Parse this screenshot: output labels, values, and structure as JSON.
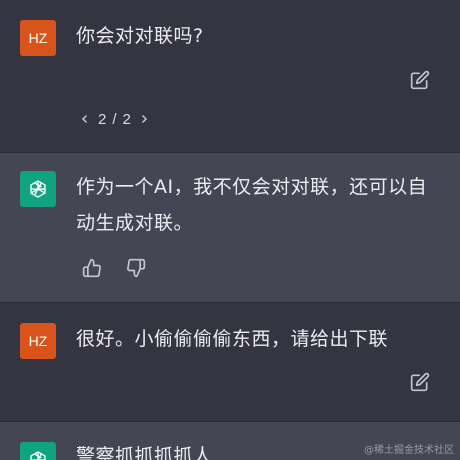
{
  "messages": [
    {
      "role": "user",
      "avatar_label": "HZ",
      "text": "你会对对联吗?",
      "pager": {
        "prev_icon": "chevron-left-icon",
        "current": "2",
        "separator": "/",
        "total": "2",
        "next_icon": "chevron-right-icon"
      },
      "edit_icon": "edit-icon"
    },
    {
      "role": "assistant",
      "avatar_icon": "openai-logo-icon",
      "text": "作为一个AI，我不仅会对对联，还可以自动生成对联。",
      "thumbs_up_icon": "thumbs-up-icon",
      "thumbs_down_icon": "thumbs-down-icon"
    },
    {
      "role": "user",
      "avatar_label": "HZ",
      "text": "很好。小偷偷偷偷东西，请给出下联",
      "edit_icon": "edit-icon"
    },
    {
      "role": "assistant",
      "avatar_icon": "openai-logo-icon",
      "text": "警察抓抓抓抓人"
    }
  ],
  "watermark": "@稀土掘金技术社区",
  "colors": {
    "user_bg": "#343541",
    "assistant_bg": "#444654",
    "user_avatar": "#d8541a",
    "assistant_avatar": "#10a37f"
  }
}
